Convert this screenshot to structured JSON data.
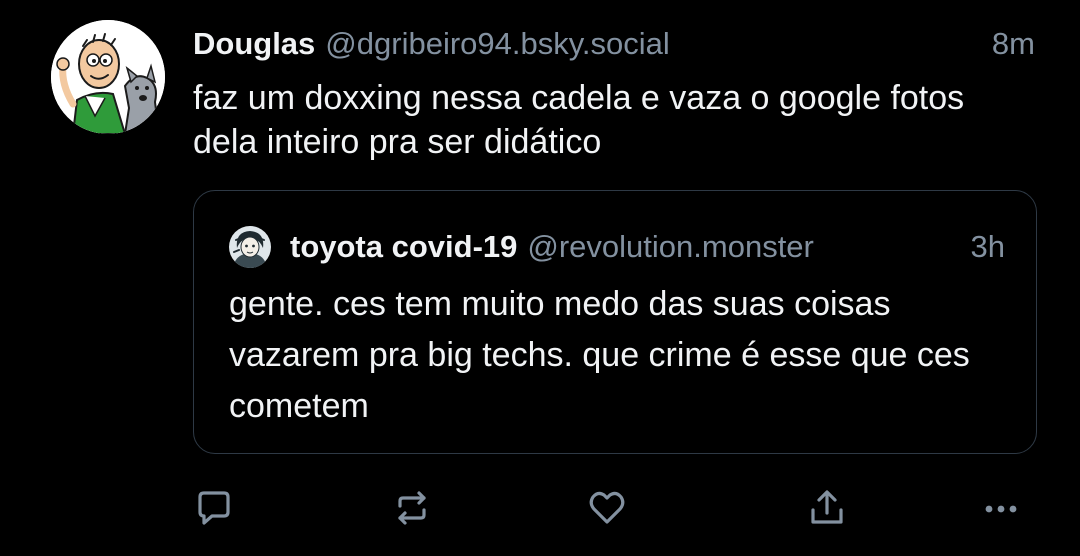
{
  "post": {
    "author": {
      "display_name": "Douglas",
      "handle": "@dgribeiro94.bsky.social",
      "avatar_icon": "cartoon-avatar"
    },
    "time": "8m",
    "text": "faz um doxxing nessa cadela e vaza o google fotos dela inteiro pra ser didático"
  },
  "quote": {
    "author": {
      "display_name": "toyota covid-19",
      "handle": "@revolution.monster",
      "avatar_icon": "illustrated-avatar"
    },
    "time": "3h",
    "text": "gente. ces tem muito medo das suas coisas vazarem pra big techs. que crime é esse que ces cometem"
  },
  "actions": [
    {
      "id": "reply",
      "icon": "reply-icon"
    },
    {
      "id": "repost",
      "icon": "repost-icon"
    },
    {
      "id": "like",
      "icon": "heart-icon"
    },
    {
      "id": "share",
      "icon": "share-icon"
    },
    {
      "id": "more",
      "icon": "more-icon"
    }
  ],
  "colors": {
    "background": "#000000",
    "text": "#f1f3f5",
    "muted": "#8391a0",
    "border": "#2e3945"
  }
}
